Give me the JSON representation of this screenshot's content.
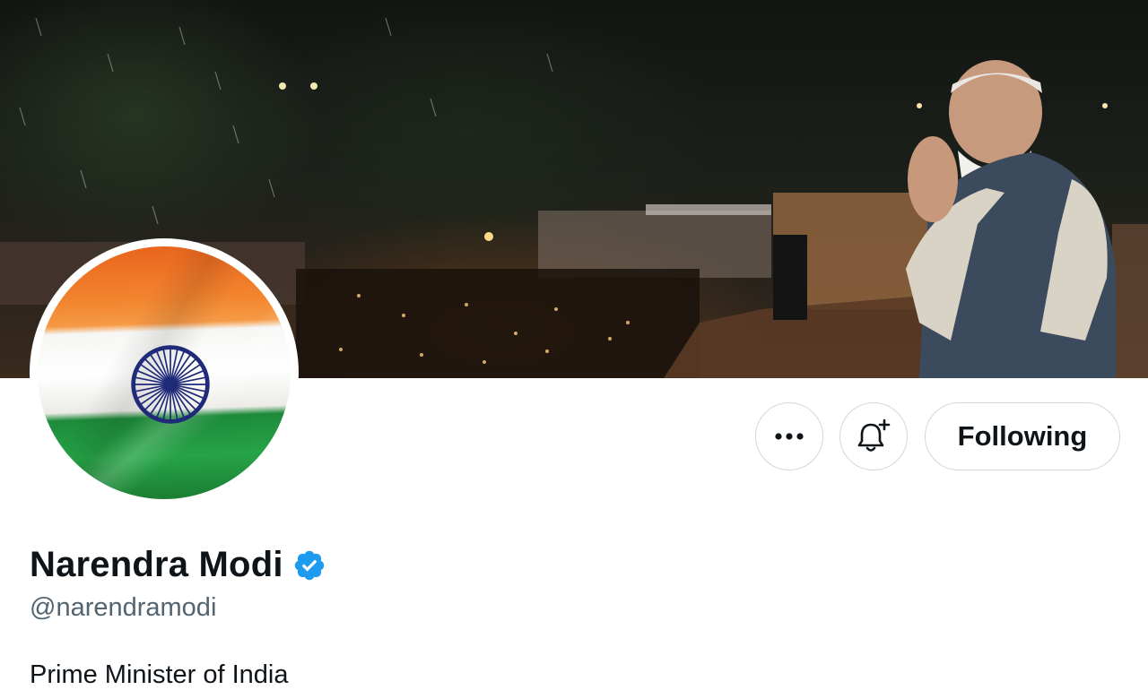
{
  "profile": {
    "display_name": "Narendra Modi",
    "handle": "@narendramodi",
    "bio": "Prime Minister of India",
    "verified": true
  },
  "actions": {
    "more_icon": "more-horizontal-icon",
    "notify_icon": "bell-plus-icon",
    "follow_label": "Following"
  },
  "colors": {
    "verified_blue": "#1d9bf0",
    "text_primary": "#0f1419",
    "text_secondary": "#536471",
    "button_border": "#cfd9de",
    "saffron": "#f3852f",
    "india_green": "#26a447",
    "chakra_navy": "#1f2a78"
  }
}
